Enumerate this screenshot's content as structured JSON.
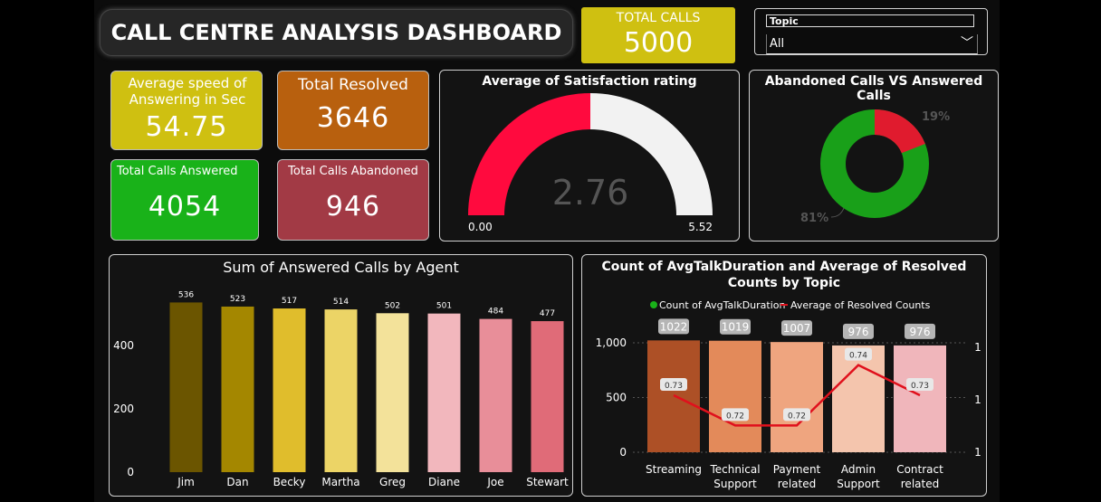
{
  "header": {
    "title": "CALL CENTRE ANALYSIS DASHBOARD"
  },
  "total_calls": {
    "label": "TOTAL CALLS",
    "value": "5000"
  },
  "slicer": {
    "label": "Topic",
    "selected": "All"
  },
  "kpis": {
    "avg_speed": {
      "label": "Average speed of Answering in Sec",
      "value": "54.75",
      "color": "#cfc011"
    },
    "total_resolved": {
      "label": "Total Resolved",
      "value": "3646",
      "color": "#b8600e"
    },
    "answered": {
      "label": "Total Calls Answered",
      "value": "4054",
      "color": "#19b219"
    },
    "abandoned": {
      "label": "Total Calls Abandoned",
      "value": "946",
      "color": "#a23a45"
    }
  },
  "gauge": {
    "title": "Average of Satisfaction rating",
    "value": "2.76",
    "min": "0.00",
    "max": "5.52"
  },
  "donut": {
    "title": "Abandoned Calls VS Answered Calls",
    "label_small": "19%",
    "label_large": "81%"
  },
  "chart_data": [
    {
      "type": "bar",
      "title": "Sum of Answered Calls by Agent",
      "categories": [
        "Jim",
        "Dan",
        "Becky",
        "Martha",
        "Greg",
        "Diane",
        "Joe",
        "Stewart"
      ],
      "values": [
        536,
        523,
        517,
        514,
        502,
        501,
        484,
        477
      ],
      "value_labels": [
        "536",
        "523",
        "517",
        "514",
        "502",
        "501",
        "484",
        "477"
      ],
      "colors": [
        "#6b5500",
        "#a48700",
        "#e0bd2c",
        "#ecd466",
        "#f3e29a",
        "#f2b7bd",
        "#e88e99",
        "#e06b78"
      ],
      "yticks": [
        "0",
        "200",
        "400"
      ],
      "ylim": [
        0,
        600
      ]
    },
    {
      "type": "bar+line",
      "title": "Count of AvgTalkDuration and Average of Resolved Counts by Topic",
      "legend": [
        "Count of AvgTalkDuration",
        "Average of Resolved Counts"
      ],
      "categories": [
        "Streaming",
        "Technical Support",
        "Payment related",
        "Admin Support",
        "Contract related"
      ],
      "bar_values": [
        1022,
        1019,
        1007,
        976,
        976
      ],
      "bar_labels": [
        "1022",
        "1019",
        "1007",
        "976",
        "976"
      ],
      "bar_colors": [
        "#ad5026",
        "#e38a5a",
        "#efa57f",
        "#f4c5ad",
        "#f0b6bb"
      ],
      "line_values": [
        0.73,
        0.72,
        0.72,
        0.74,
        0.73
      ],
      "line_labels": [
        "0.73",
        "0.72",
        "0.72",
        "0.74",
        "0.73"
      ],
      "yticks_left": [
        "0",
        "500",
        "1,000"
      ],
      "yticks_right": [
        "1",
        "1",
        "1"
      ],
      "ylim": [
        0,
        1000
      ]
    }
  ]
}
